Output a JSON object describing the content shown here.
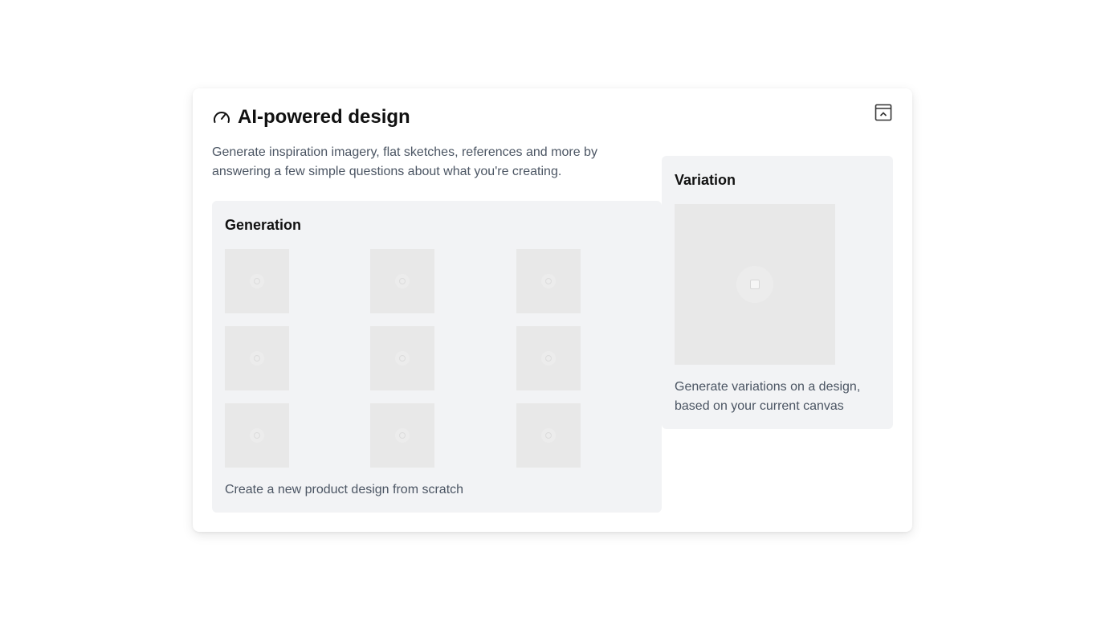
{
  "header": {
    "title": "AI-powered design",
    "icon": "gauge-icon",
    "collapse_icon": "collapse-panel-icon"
  },
  "description": "Generate inspiration imagery, flat sketches, references and more by answering a few simple questions about what you're creating.",
  "generation": {
    "title": "Generation",
    "caption": "Create a new product design from scratch",
    "thumbnail_count": 9,
    "thumbnail_icon": "image-placeholder-icon"
  },
  "variation": {
    "title": "Variation",
    "caption": "Generate variations on a design, based on your current canvas",
    "preview_icon": "image-placeholder-icon"
  },
  "colors": {
    "card_background": "#f2f3f5",
    "thumbnail_background": "#e8e8e8",
    "title_text": "#111111",
    "body_text": "#4b5563"
  }
}
